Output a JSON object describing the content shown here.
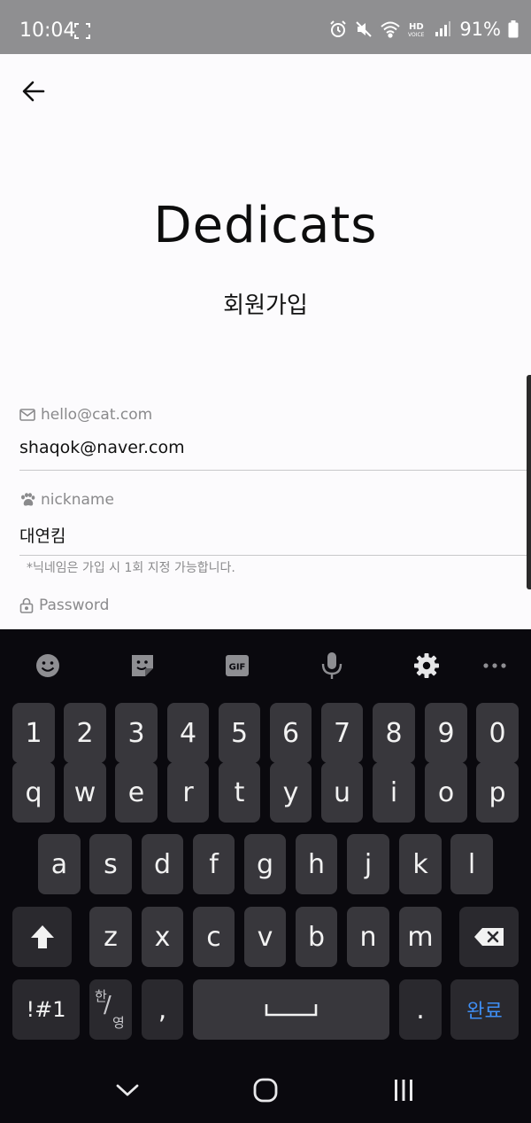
{
  "status_bar": {
    "time": "10:04",
    "battery": "91%",
    "icons": [
      "screenshot-icon",
      "alarm-icon",
      "mute-icon",
      "wifi-icon",
      "hd-voice-icon",
      "signal-icon",
      "battery-icon"
    ]
  },
  "header": {
    "back_icon": "arrow-left-icon",
    "app_title": "Dedicats",
    "subtitle": "회원가입"
  },
  "form": {
    "email": {
      "label": "hello@cat.com",
      "value": "shaqok@naver.com",
      "icon": "mail-icon"
    },
    "nickname": {
      "label": "nickname",
      "value": "대연킴",
      "icon": "paw-icon",
      "hint": "*닉네임은 가입 시 1회 지정 가능합니다."
    },
    "password": {
      "label": "Password",
      "icon": "lock-icon"
    }
  },
  "keyboard": {
    "toolbar": [
      "emoji-icon",
      "sticker-icon",
      "gif-icon",
      "mic-icon",
      "gear-icon",
      "more-icon"
    ],
    "gif_label": "GIF",
    "rows": {
      "numbers": [
        "1",
        "2",
        "3",
        "4",
        "5",
        "6",
        "7",
        "8",
        "9",
        "0"
      ],
      "row1": [
        "q",
        "w",
        "e",
        "r",
        "t",
        "y",
        "u",
        "i",
        "o",
        "p"
      ],
      "row2": [
        "a",
        "s",
        "d",
        "f",
        "g",
        "h",
        "j",
        "k",
        "l"
      ],
      "row3": [
        "z",
        "x",
        "c",
        "v",
        "b",
        "n",
        "m"
      ]
    },
    "symbols_label": "!#1",
    "lang_top": "한",
    "lang_bottom": "영",
    "comma": ",",
    "period": ".",
    "done_label": "완료"
  },
  "nav": [
    "back-chevron-icon",
    "home-icon",
    "recents-icon"
  ],
  "colors": {
    "status_bar": "#8f8f91",
    "keyboard_bg": "#0a090e",
    "key_bg": "#38373c",
    "done_accent": "#3f8ff5"
  }
}
